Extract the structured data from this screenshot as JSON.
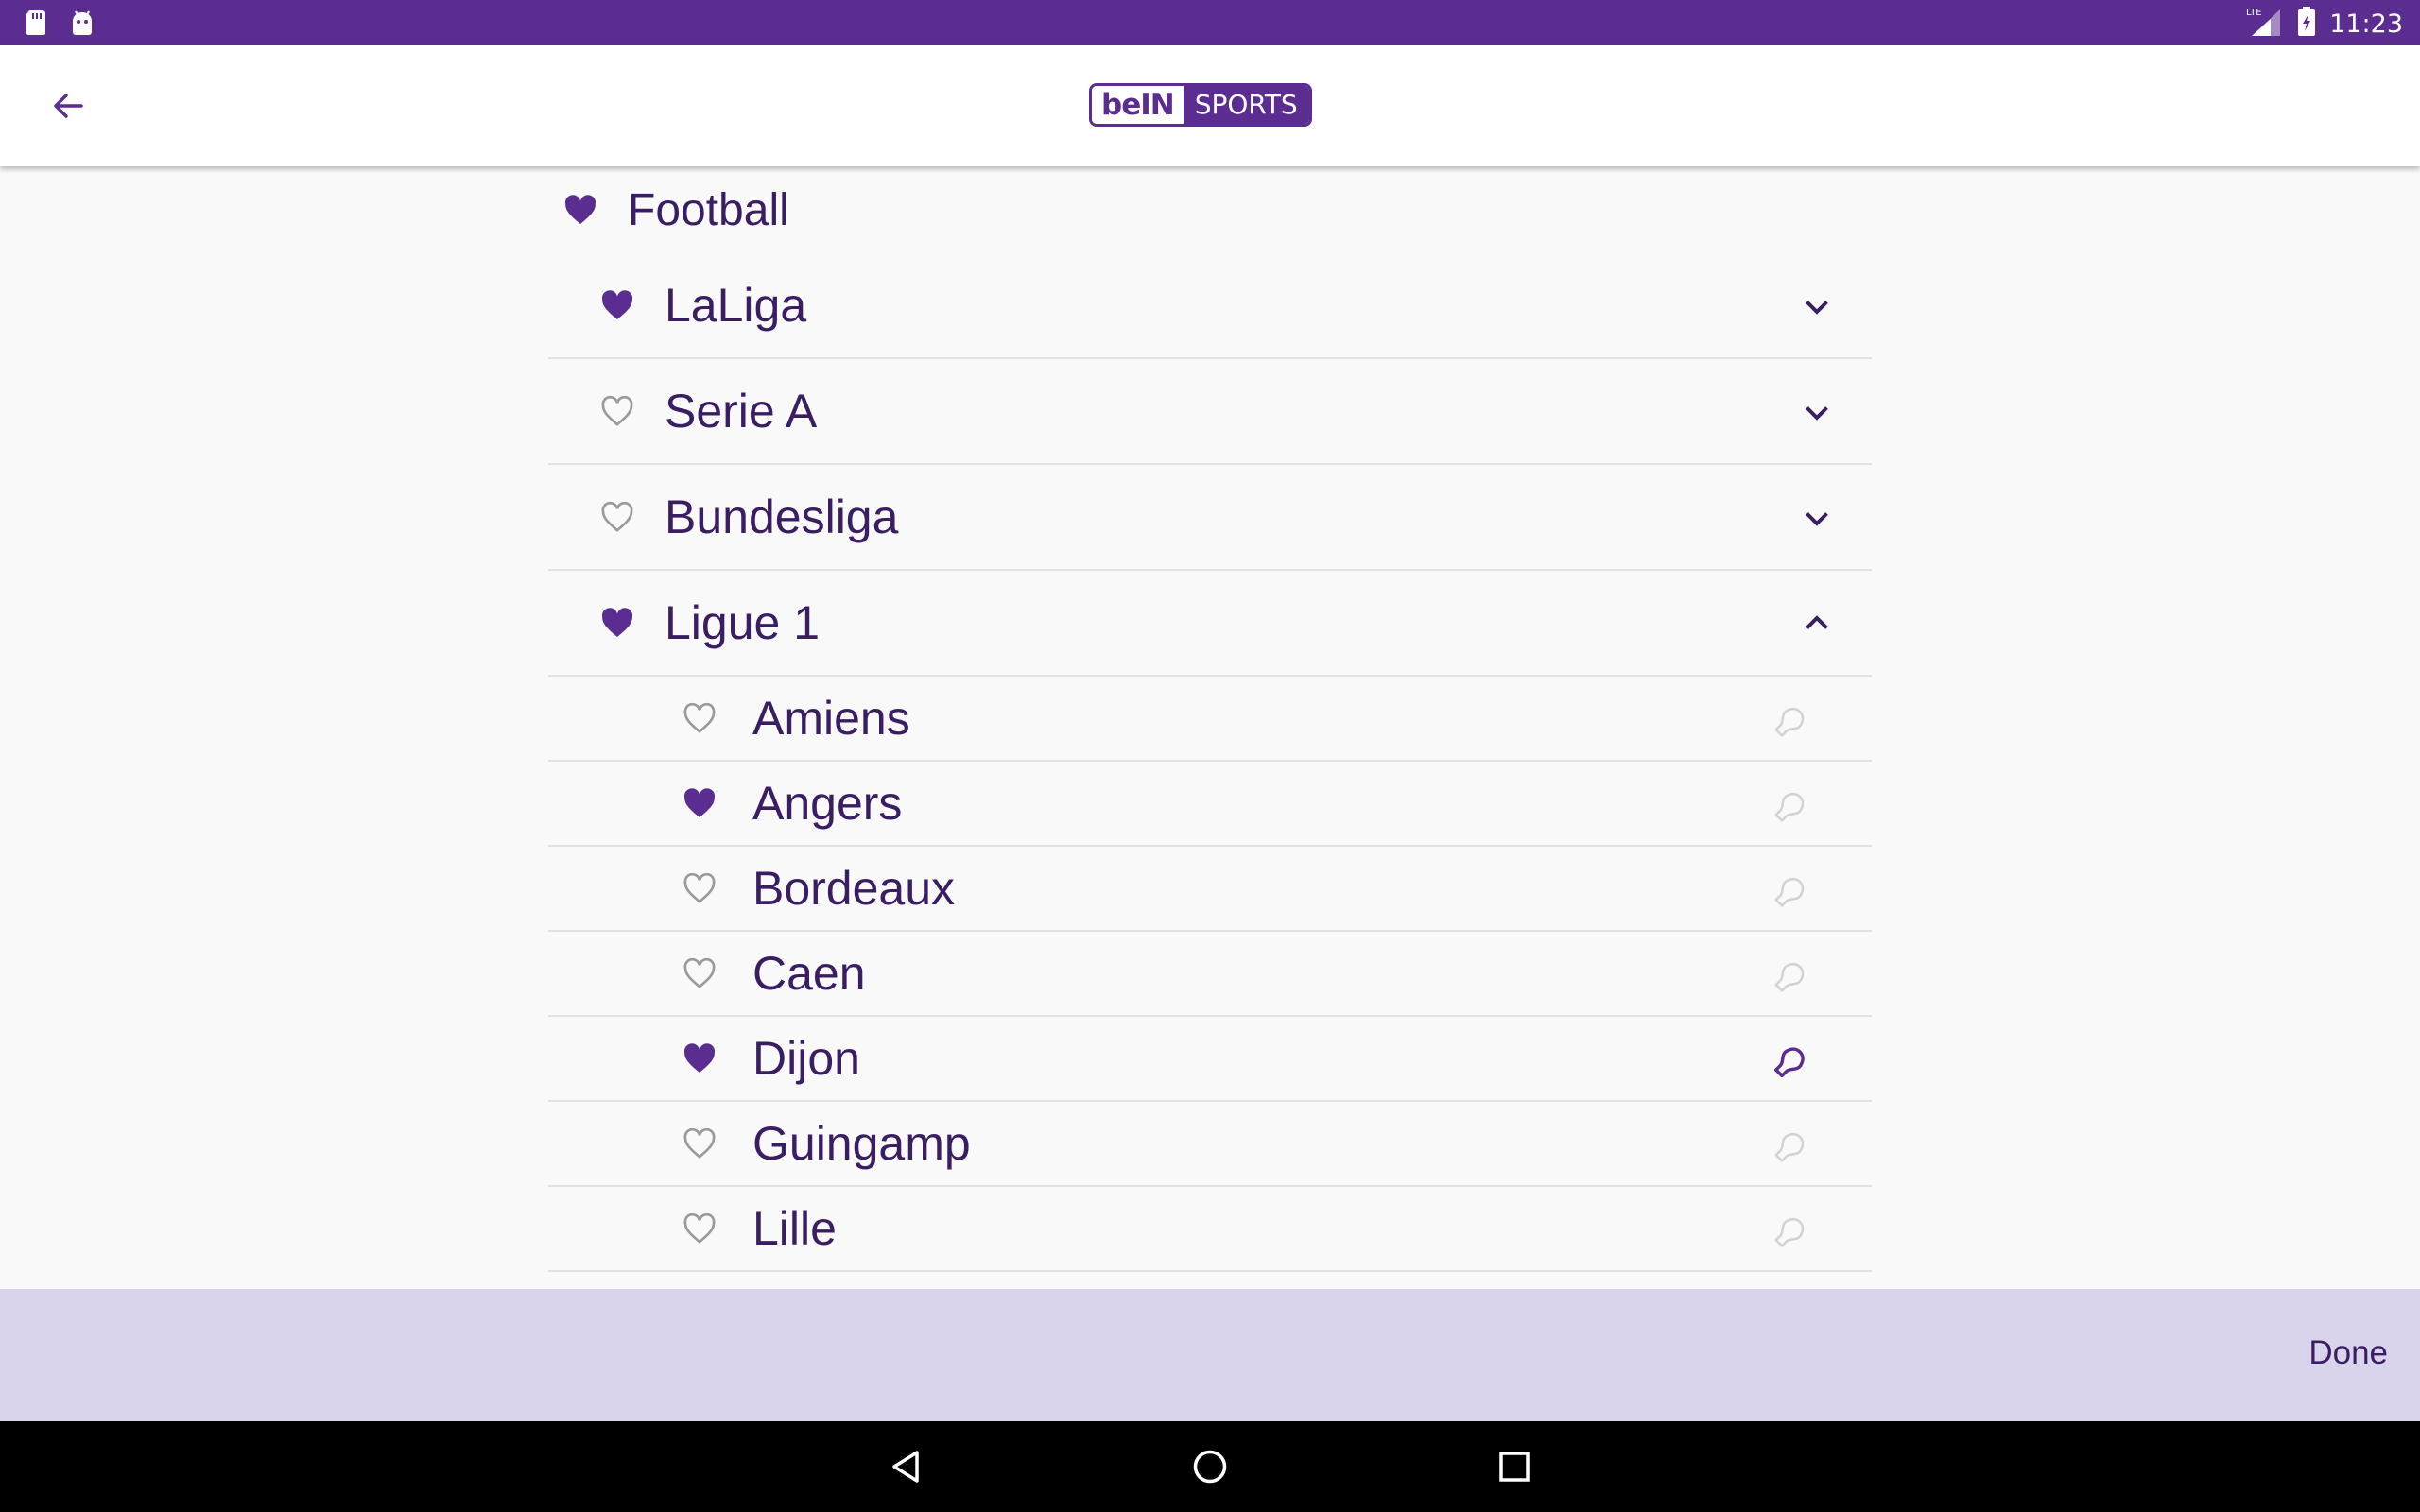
{
  "status_bar": {
    "time": "11:23",
    "network": "LTE",
    "icons": [
      "sd-card-icon",
      "android-icon",
      "signal-icon",
      "battery-icon"
    ]
  },
  "app_bar": {
    "back_icon": "arrow-back-icon",
    "logo_part1": "beIN",
    "logo_part2": "SPORTS"
  },
  "colors": {
    "brand": "#5b2d91",
    "text": "#3a1e63",
    "bottom_bar": "#d9d4eb",
    "heart_outline": "#9a9a9a"
  },
  "sport": {
    "name": "Football",
    "favorite": true
  },
  "leagues": [
    {
      "name": "LaLiga",
      "favorite": true,
      "expanded": false
    },
    {
      "name": "Serie A",
      "favorite": false,
      "expanded": false
    },
    {
      "name": "Bundesliga",
      "favorite": false,
      "expanded": false
    },
    {
      "name": "Ligue 1",
      "favorite": true,
      "expanded": true
    }
  ],
  "teams": [
    {
      "name": "Amiens",
      "favorite": false,
      "notify": false
    },
    {
      "name": "Angers",
      "favorite": true,
      "notify": false
    },
    {
      "name": "Bordeaux",
      "favorite": false,
      "notify": false
    },
    {
      "name": "Caen",
      "favorite": false,
      "notify": false
    },
    {
      "name": "Dijon",
      "favorite": true,
      "notify": true
    },
    {
      "name": "Guingamp",
      "favorite": false,
      "notify": false
    },
    {
      "name": "Lille",
      "favorite": false,
      "notify": false
    }
  ],
  "bottom_bar": {
    "done_label": "Done"
  },
  "nav_bar": {
    "icons": [
      "nav-back-icon",
      "nav-home-icon",
      "nav-recents-icon"
    ]
  }
}
